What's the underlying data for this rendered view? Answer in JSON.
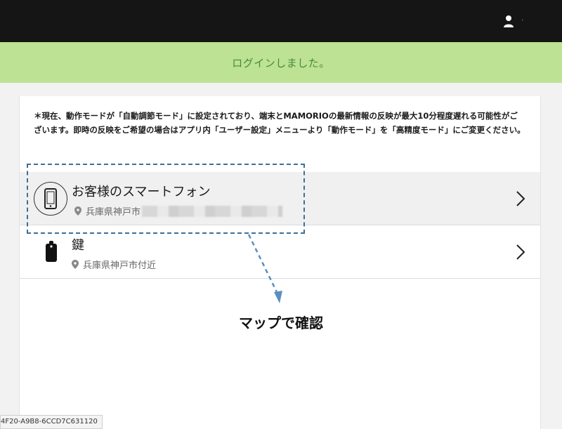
{
  "header": {
    "user_name": "·"
  },
  "banner": {
    "message": "ログインしました。"
  },
  "notice": {
    "text": "＊現在、動作モードが「自動調節モード」に設定されており、端末とMAMORIOの最新情報の反映が最大10分程度遅れる可能性がございます。即時の反映をご希望の場合はアプリ内「ユーザー設定」メニューより「動作モード」を「高精度モード」にご変更ください。"
  },
  "devices": [
    {
      "name": "お客様のスマートフォン",
      "location": "兵庫県神戸市",
      "icon": "smartphone-icon"
    },
    {
      "name": "鍵",
      "location": "兵庫県神戸市付近",
      "icon": "tag-icon"
    }
  ],
  "annotation": {
    "label": "マップで確認",
    "color": "#3e6f96"
  },
  "footer": {
    "session_id": "4F20-A9B8-6CCD7C631120"
  },
  "colors": {
    "topbar": "#151515",
    "banner_bg": "#bde294",
    "banner_text": "#4a8a3c"
  }
}
